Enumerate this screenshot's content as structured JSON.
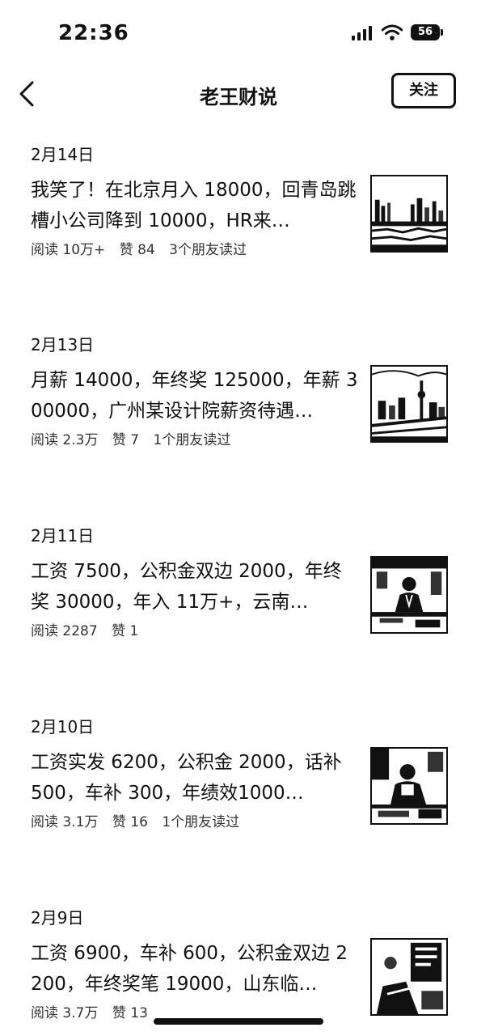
{
  "status_bar": {
    "time": "22:36",
    "battery": "56"
  },
  "nav": {
    "title": "老王财说",
    "follow_label": "关注"
  },
  "articles": [
    {
      "date": "2月14日",
      "title": "我笑了！在北京月入 18000，回青岛跳槽小公司降到 10000，HR来…",
      "reads": "阅读 10万+",
      "likes": "赞 84",
      "friends": "3个朋友读过",
      "thumbnail": "city-waterfront-thumbnail"
    },
    {
      "date": "2月13日",
      "title": "月薪 14000，年终奖 125000，年薪 300000，广州某设计院薪资待遇…",
      "reads": "阅读 2.3万",
      "likes": "赞 7",
      "friends": "1个朋友读过",
      "thumbnail": "city-tower-thumbnail"
    },
    {
      "date": "2月11日",
      "title": "工资 7500，公积金双边 2000，年终奖 30000，年入 11万+，云南…",
      "reads": "阅读 2287",
      "likes": "赞 1",
      "friends": "",
      "thumbnail": "office-worker-thumbnail"
    },
    {
      "date": "2月10日",
      "title": "工资实发 6200，公积金 2000，话补 500，车补 300，年绩效1000…",
      "reads": "阅读 3.1万",
      "likes": "赞 16",
      "friends": "1个朋友读过",
      "thumbnail": "office-desk-thumbnail"
    },
    {
      "date": "2月9日",
      "title": "工资 6900，车补 600，公积金双边 2200，年终奖笔 19000，山东临…",
      "reads": "阅读 3.7万",
      "likes": "赞 13",
      "friends": "",
      "thumbnail": "document-thumbnail"
    }
  ]
}
